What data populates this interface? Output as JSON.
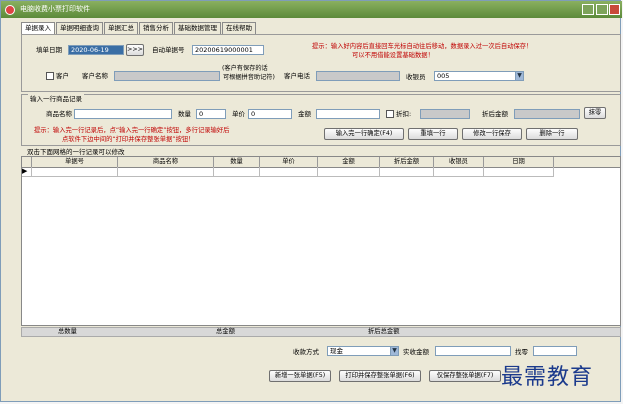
{
  "window": {
    "title": "电脑收费小票打印软件"
  },
  "tabs": [
    "单据录入",
    "单据明细查询",
    "单据汇总",
    "销售分析",
    "基础数据管理",
    "在线帮助"
  ],
  "header": {
    "date_label": "填单日期",
    "date_value": "2020-06-19",
    "date_btn": ">>>",
    "auto_no_label": "自动单据号",
    "auto_no_value": "20200619000001",
    "tip_line1": "提示：输入好内容后直接回车光标自动往后移动，数据录入过一次后自动保存！",
    "tip_line2": "可以不用借能设置基础数据！",
    "customer_check": "客户",
    "customer_name_label": "客户名称",
    "customer_note_line1": "(客户有保存的话",
    "customer_note_line2": "可根据拼音助记符)",
    "phone_label": "客户电话",
    "cashier_label": "收银员",
    "cashier_value": "005"
  },
  "entry": {
    "group_title": "输入一行商品记录",
    "product_label": "商品名称",
    "qty_label": "数量",
    "qty_value": "0",
    "price_label": "单价",
    "price_value": "0",
    "amount_label": "金额",
    "discount_check": "折扣:",
    "after_discount_label": "折后金额",
    "clear_btn": "抹零",
    "tip_line1": "提示：输入完一行记录后，点“输入完一行确定”按钮，多行记录输好后",
    "tip_line2": "点软件下边中间的“打印并保存整张单据”按钮！",
    "confirm_btn": "输入完一行确定(F4)",
    "refill_btn": "重填一行",
    "modify_btn": "修改一行保存",
    "delete_btn": "删除一行"
  },
  "grid": {
    "hint": "双击下面网格的一行记录可以修改",
    "columns": [
      "单据号",
      "商品名称",
      "数量",
      "单价",
      "金额",
      "折后金额",
      "收银员",
      "日期"
    ]
  },
  "totals": {
    "total_qty": "总数量",
    "total_amount": "总金额",
    "total_discount": "折后总金额"
  },
  "footer": {
    "pay_label": "收款方式",
    "pay_value": "现金",
    "received_label": "实收金额",
    "change_label": "找零",
    "new_btn": "新增一张单据(F5)",
    "print_btn": "打印并保存整张单据(F6)",
    "save_btn": "仅保存整张单据(F7)"
  },
  "watermark": "最需教育"
}
